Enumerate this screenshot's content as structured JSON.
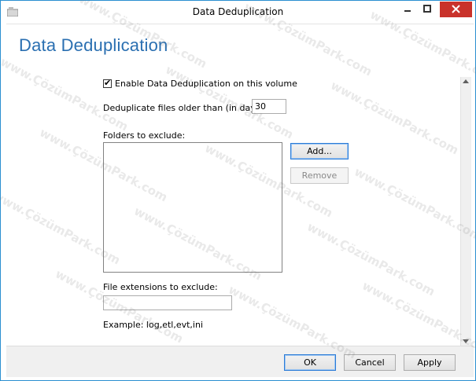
{
  "window": {
    "title": "Data Deduplication",
    "controls": {
      "minimize": "minimize",
      "maximize": "maximize",
      "close": "close"
    }
  },
  "heading": "Data Deduplication",
  "enable_checkbox": {
    "label": "Enable Data Deduplication on this volume",
    "checked": true
  },
  "age_field": {
    "label": "Deduplicate files older than (in days):",
    "value": "30"
  },
  "folders": {
    "label": "Folders to exclude:",
    "items": [],
    "add_button": "Add...",
    "remove_button": "Remove"
  },
  "extensions": {
    "label": "File extensions to exclude:",
    "value": "",
    "example": "Example: log,etl,evt,ini"
  },
  "footer": {
    "ok": "OK",
    "cancel": "Cancel",
    "apply": "Apply"
  },
  "watermark_text": "www.ÇözümPark.com",
  "colors": {
    "accent": "#2a6fb1",
    "close_button": "#c9322b",
    "window_border": "#2b8fd0"
  }
}
